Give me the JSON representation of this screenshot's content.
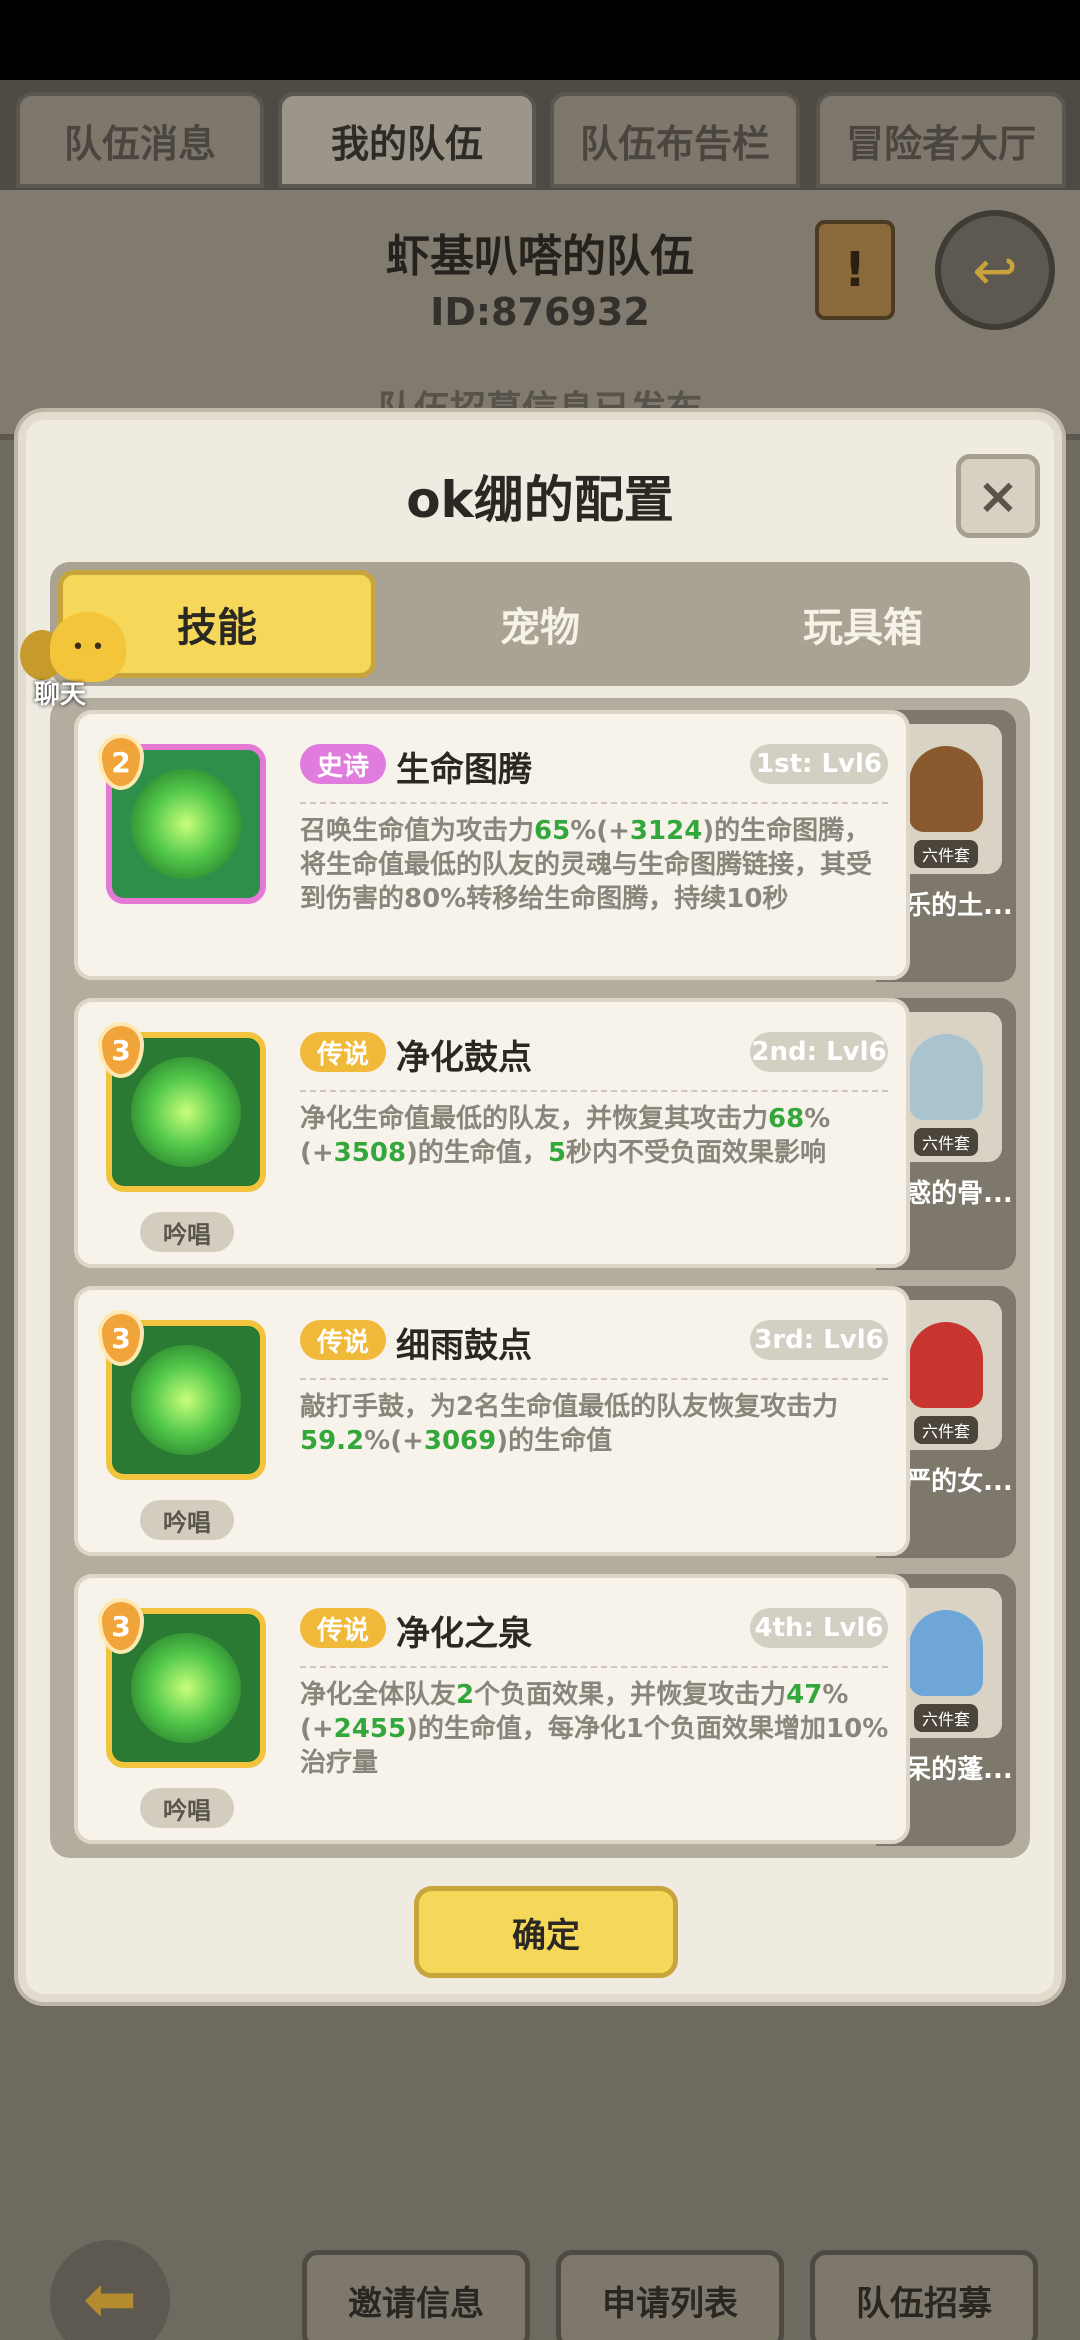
{
  "top_tabs": [
    "队伍消息",
    "我的队伍",
    "队伍布告栏",
    "冒险者大厅"
  ],
  "team": {
    "name": "虾基叭嗒的队伍",
    "id": "ID:876932",
    "published_notice": "队伍招募信息已发布"
  },
  "bottom_buttons": [
    "邀请信息",
    "申请列表",
    "队伍招募"
  ],
  "chat": {
    "label": "聊天"
  },
  "modal": {
    "title": "ok绷的配置",
    "close_label": "×",
    "tabs": [
      "技能",
      "宠物",
      "玩具箱"
    ],
    "active_tab": "技能",
    "confirm_label": "确定"
  },
  "skills": [
    {
      "level": "2",
      "rarity": "史诗",
      "name": "生命图腾",
      "slot": "1st: Lvl6",
      "chant": "",
      "desc_parts": [
        "召唤生命值为攻击力",
        "65",
        "%(+",
        "3124",
        ")的生命图腾，将生命值最低的队友的灵魂与生命图腾链接，其受到伤害的80%转移给生命图腾，持续10秒"
      ],
      "pet_name": "快乐的土...",
      "pet_badge": "六件套"
    },
    {
      "level": "3",
      "rarity": "传说",
      "name": "净化鼓点",
      "slot": "2nd: Lvl6",
      "chant": "吟唱",
      "desc_parts": [
        "净化生命值最低的队友，并恢复其攻击力",
        "68",
        "%(+",
        "3508",
        ")的生命值，",
        "5",
        "秒内不受负面效果影响"
      ],
      "pet_name": "困惑的骨...",
      "pet_badge": "六件套"
    },
    {
      "level": "3",
      "rarity": "传说",
      "name": "细雨鼓点",
      "slot": "3rd: Lvl6",
      "chant": "吟唱",
      "desc_parts": [
        "敲打手鼓，为2名生命值最低的队友恢复攻击力",
        "59.2",
        "%(+",
        "3069",
        ")的生命值"
      ],
      "pet_name": "威严的女...",
      "pet_badge": "六件套"
    },
    {
      "level": "3",
      "rarity": "传说",
      "name": "净化之泉",
      "slot": "4th: Lvl6",
      "chant": "吟唱",
      "desc_parts": [
        "净化全体队友",
        "2",
        "个负面效果，并恢复攻击力",
        "47",
        "%(+",
        "2455",
        ")的生命值，每净化1个负面效果增加10%治疗量"
      ],
      "pet_name": "发呆的蓬...",
      "pet_badge": "六件套"
    }
  ],
  "colors": {
    "accent_yellow": "#f5d85a",
    "epic": "#e07cdd",
    "legend": "#f0b93a",
    "highlight_green": "#34a73c"
  }
}
